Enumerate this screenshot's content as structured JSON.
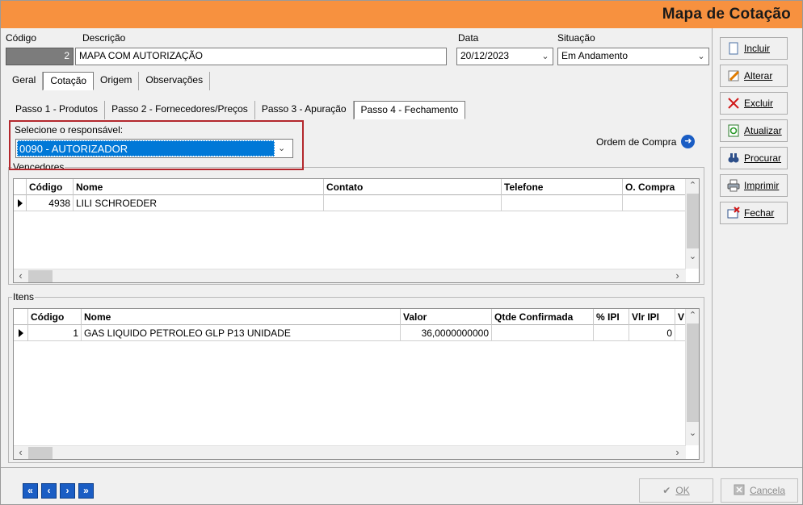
{
  "window": {
    "title": "Mapa de Cotação"
  },
  "header": {
    "codigo_label": "Código",
    "codigo_value": "2",
    "descricao_label": "Descrição",
    "descricao_value": "MAPA COM AUTORIZAÇÃO",
    "data_label": "Data",
    "data_value": "20/12/2023",
    "situacao_label": "Situação",
    "situacao_value": "Em Andamento"
  },
  "tabs": [
    "Geral",
    "Cotação",
    "Origem",
    "Observações"
  ],
  "steps": [
    "Passo 1 - Produtos",
    "Passo 2 - Fornecedores/Preços",
    "Passo 3 - Apuração",
    "Passo 4 - Fechamento"
  ],
  "responsavel": {
    "label": "Selecione o responsável:",
    "value": "0090 - AUTORIZADOR"
  },
  "ordem_compra": {
    "label": "Ordem de Compra"
  },
  "vencedores": {
    "title": "Vencedores",
    "columns": [
      "Código",
      "Nome",
      "Contato",
      "Telefone",
      "O. Compra"
    ],
    "rows": [
      {
        "codigo": "4938",
        "nome": "LILI SCHROEDER",
        "contato": "",
        "telefone": "",
        "ocompra": ""
      }
    ]
  },
  "itens": {
    "title": "Itens",
    "columns": [
      "Código",
      "Nome",
      "Valor",
      "Qtde Confirmada",
      "% IPI",
      "Vlr IPI",
      "V"
    ],
    "rows": [
      {
        "codigo": "1",
        "nome": "GAS LIQUIDO PETROLEO GLP P13 UNIDADE",
        "valor": "36,0000000000",
        "qtde": "",
        "ipi": "",
        "vlr_ipi": "0"
      }
    ]
  },
  "actions": {
    "incluir": "Incluir",
    "alterar": "Alterar",
    "excluir": "Excluir",
    "atualizar": "Atualizar",
    "procurar": "Procurar",
    "imprimir": "Imprimir",
    "fechar": "Fechar"
  },
  "bottom": {
    "ok": "OK",
    "cancela": "Cancela"
  },
  "colors": {
    "title_bar": "#f7913f",
    "accent_blue": "#1a5dc4",
    "highlight_border": "#b3282d",
    "selection": "#0078d7"
  }
}
